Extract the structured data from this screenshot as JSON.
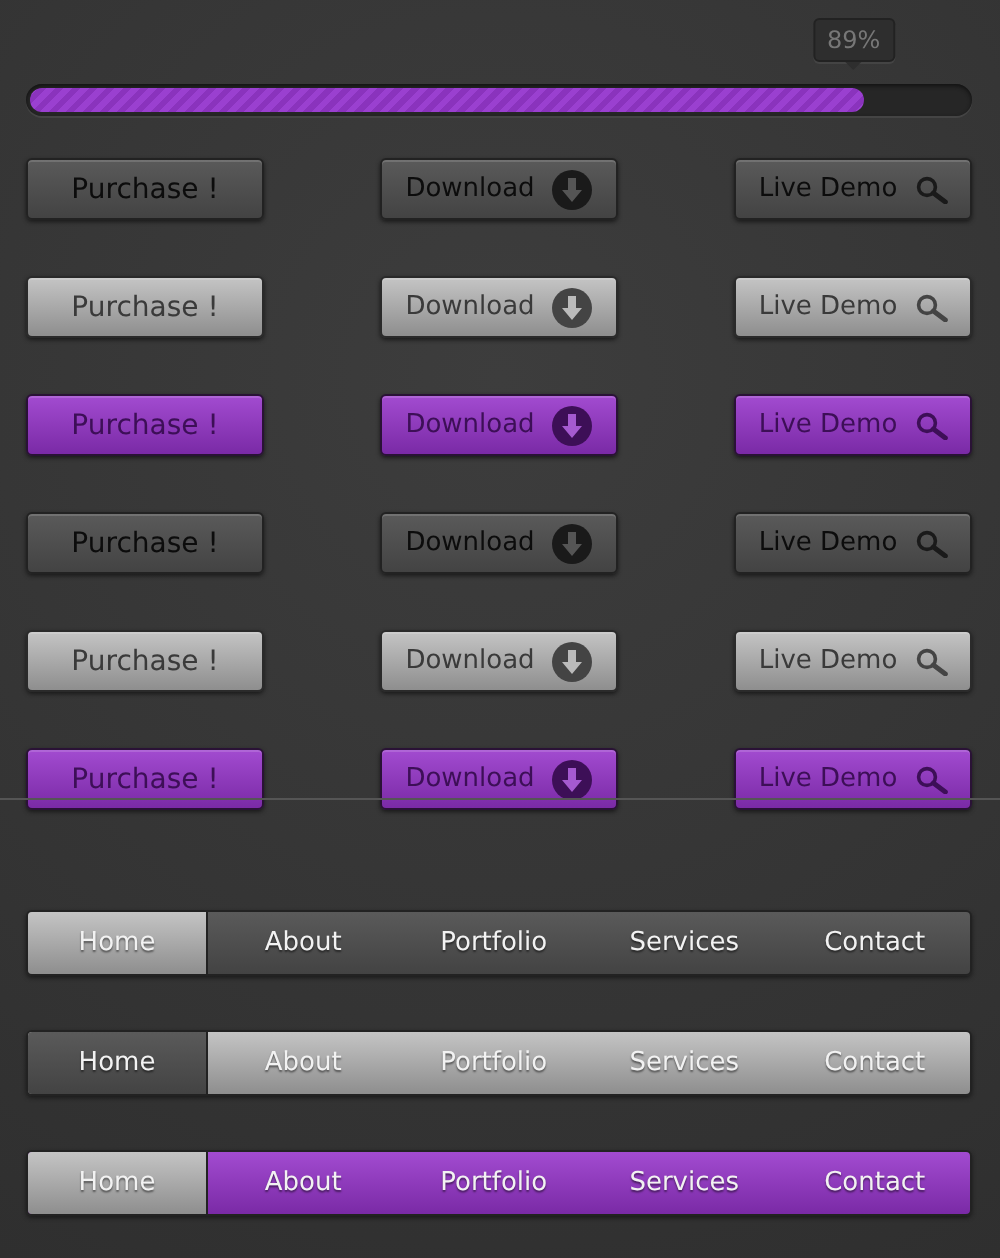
{
  "progress": {
    "level": 0.89,
    "reading": "89%"
  },
  "button_rows": [
    {
      "kind": "dark",
      "buttons": [
        {
          "kind": "plain",
          "label": "Purchase !"
        },
        {
          "kind": "download",
          "label": "Download"
        },
        {
          "kind": "search",
          "label": "Live Demo"
        }
      ]
    },
    {
      "kind": "light",
      "buttons": [
        {
          "kind": "plain",
          "label": "Purchase !"
        },
        {
          "kind": "download",
          "label": "Download"
        },
        {
          "kind": "search",
          "label": "Live Demo"
        }
      ]
    },
    {
      "kind": "purple",
      "buttons": [
        {
          "kind": "plain",
          "label": "Purchase !"
        },
        {
          "kind": "download",
          "label": "Download"
        },
        {
          "kind": "search",
          "label": "Live Demo"
        }
      ]
    },
    {
      "kind": "dark",
      "buttons": [
        {
          "kind": "plain",
          "label": "Purchase !"
        },
        {
          "kind": "download",
          "label": "Download"
        },
        {
          "kind": "search",
          "label": "Live Demo"
        }
      ]
    },
    {
      "kind": "light",
      "buttons": [
        {
          "kind": "plain",
          "label": "Purchase !"
        },
        {
          "kind": "download",
          "label": "Download"
        },
        {
          "kind": "search",
          "label": "Live Demo"
        }
      ]
    },
    {
      "kind": "purple",
      "buttons": [
        {
          "kind": "plain",
          "label": "Purchase !"
        },
        {
          "kind": "download",
          "label": "Download"
        },
        {
          "kind": "search",
          "label": "Live Demo"
        }
      ]
    }
  ],
  "nav_bars": [
    {
      "kind": "dark",
      "items": [
        {
          "label": "Home",
          "selected": true
        },
        {
          "label": "About",
          "selected": false
        },
        {
          "label": "Portfolio",
          "selected": false
        },
        {
          "label": "Services",
          "selected": false
        },
        {
          "label": "Contact",
          "selected": false
        }
      ]
    },
    {
      "kind": "light",
      "items": [
        {
          "label": "Home",
          "selected": true
        },
        {
          "label": "About",
          "selected": false
        },
        {
          "label": "Portfolio",
          "selected": false
        },
        {
          "label": "Services",
          "selected": false
        },
        {
          "label": "Contact",
          "selected": false
        }
      ]
    },
    {
      "kind": "purple",
      "items": [
        {
          "label": "Home",
          "selected": true
        },
        {
          "label": "About",
          "selected": false
        },
        {
          "label": "Portfolio",
          "selected": false
        },
        {
          "label": "Services",
          "selected": false
        },
        {
          "label": "Contact",
          "selected": false
        }
      ]
    }
  ]
}
